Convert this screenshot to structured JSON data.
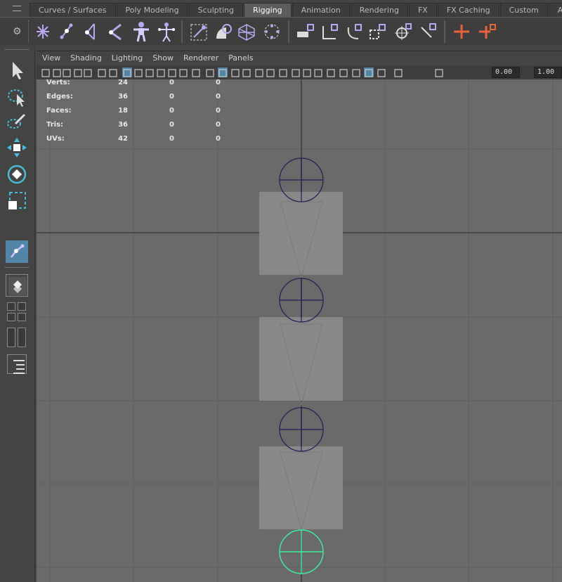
{
  "shelf_tabs": [
    "Curves / Surfaces",
    "Poly Modeling",
    "Sculpting",
    "Rigging",
    "Animation",
    "Rendering",
    "FX",
    "FX Caching",
    "Custom",
    "Ar"
  ],
  "active_tab": "Rigging",
  "panel_menu": [
    "View",
    "Shading",
    "Lighting",
    "Show",
    "Renderer",
    "Panels"
  ],
  "viewport_fields": {
    "exposure": "0.00",
    "gamma": "1.00"
  },
  "hud": {
    "rows": [
      {
        "label": "Verts:",
        "values": [
          "24",
          "0",
          "0"
        ]
      },
      {
        "label": "Edges:",
        "values": [
          "36",
          "0",
          "0"
        ]
      },
      {
        "label": "Faces:",
        "values": [
          "18",
          "0",
          "0"
        ]
      },
      {
        "label": "Tris:",
        "values": [
          "36",
          "0",
          "0"
        ]
      },
      {
        "label": "UVs:",
        "values": [
          "42",
          "0",
          "0"
        ]
      }
    ]
  },
  "colors": {
    "viewport_bg": "#6a6a6a",
    "grid_line": "#5a5a5a",
    "axis_line": "#3a3a3a",
    "joint": "#2a1a55",
    "selected_joint": "#3cf0a0",
    "cube": "#888888",
    "accent_active": "#5285a6",
    "constraint_orange": "#e8623a"
  },
  "icons": {
    "shelf": [
      "joint-tool-icon",
      "ik-handle-icon",
      "ik-spline-icon",
      "bend-joint-icon",
      "humanik-icon",
      "quick-rig-icon",
      "bind-skin-icon",
      "smooth-bind-icon",
      "lattice-icon",
      "cluster-icon",
      "parent-constraint-icon",
      "point-constraint-icon",
      "orient-constraint-icon",
      "scale-constraint-icon",
      "aim-constraint-icon",
      "pole-vector-icon",
      "constraint-a-icon",
      "constraint-b-icon"
    ],
    "toolbox": [
      "select-tool-icon",
      "lasso-tool-icon",
      "paint-select-icon",
      "move-tool-icon",
      "rotate-tool-icon",
      "scale-tool-icon",
      "joint-tool-icon",
      "single-view-icon",
      "four-view-icon",
      "two-view-icon",
      "outliner-icon"
    ]
  }
}
